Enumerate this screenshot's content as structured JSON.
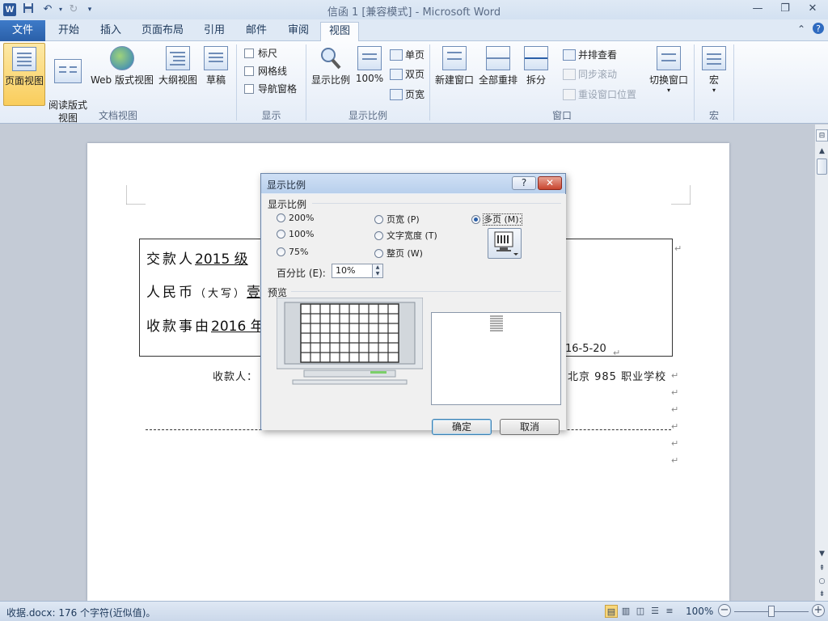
{
  "window": {
    "title": "信函 1 [兼容模式] - Microsoft Word",
    "app_icon_letter": "W",
    "controls": {
      "minimize": "—",
      "restore": "❐",
      "close": "✕"
    }
  },
  "tabs": {
    "file": "文件",
    "items": [
      "开始",
      "插入",
      "页面布局",
      "引用",
      "邮件",
      "审阅",
      "视图"
    ],
    "active": "视图"
  },
  "ribbon": {
    "doc_views": {
      "items": [
        "页面视图",
        "阅读版式\n视图",
        "Web 版式视图",
        "大纲视图",
        "草稿"
      ],
      "group_label": "文档视图"
    },
    "show": {
      "items": [
        "标尺",
        "网格线",
        "导航窗格"
      ],
      "group_label": "显示"
    },
    "zoom": {
      "zoom_label": "显示比例",
      "hundred_label": "100%",
      "one_page": "单页",
      "two_pages": "双页",
      "page_width": "页宽",
      "group_label": "显示比例"
    },
    "window": {
      "new_window": "新建窗口",
      "arrange_all": "全部重排",
      "split": "拆分",
      "side_by_side": "并排查看",
      "sync_scroll": "同步滚动",
      "reset_position": "重设窗口位置",
      "switch_windows": "切换窗口",
      "group_label": "窗口"
    },
    "macros": {
      "label": "宏",
      "group_label": "宏"
    }
  },
  "document": {
    "line1_prefix": "交款人",
    "line1_value": "2015 级",
    "line2_prefix": "人民币",
    "line2_small": "（大写）",
    "line2_value": "壹",
    "line3_prefix": "收款事由",
    "line3_value": "2016 年",
    "date": "16-5-20",
    "payee_label": "收款人：",
    "school": "北京 985 职业学校",
    "para_mark": "↵"
  },
  "dialog": {
    "title": "显示比例",
    "help": "?",
    "close": "✕",
    "zoom_group": "显示比例",
    "options": {
      "p200": "200%",
      "p100": "100%",
      "p75": "75%",
      "page_width": "页宽 (P)",
      "text_width": "文字宽度 (T)",
      "whole_page": "整页 (W)",
      "many_pages": "多页 (M):"
    },
    "selected_option": "many_pages",
    "percent_label": "百分比 (E):",
    "percent_value": "10%",
    "preview_group": "预览",
    "ok": "确定",
    "cancel": "取消"
  },
  "statusbar": {
    "text": "收据.docx: 176 个字符(近似值)。",
    "zoom": "100%",
    "zoom_level_percent": 100,
    "minus": "−",
    "plus": "+"
  }
}
